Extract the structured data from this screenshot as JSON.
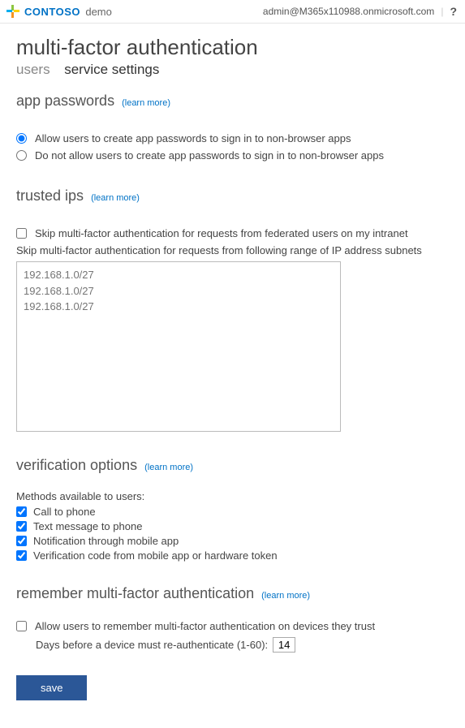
{
  "header": {
    "brand_name": "CONTOSO",
    "brand_suffix": "demo",
    "user_email": "admin@M365x110988.onmicrosoft.com",
    "help": "?"
  },
  "page": {
    "title": "multi-factor authentication"
  },
  "tabs": {
    "users": "users",
    "service_settings": "service settings"
  },
  "learn_more": "(learn more)",
  "app_passwords": {
    "heading": "app passwords",
    "allow": "Allow users to create app passwords to sign in to non-browser apps",
    "disallow": "Do not allow users to create app passwords to sign in to non-browser apps",
    "selected": "allow"
  },
  "trusted_ips": {
    "heading": "trusted ips",
    "skip_federated": "Skip multi-factor authentication for requests from federated users on my intranet",
    "skip_federated_checked": false,
    "range_label": "Skip multi-factor authentication for requests from following range of IP address subnets",
    "placeholder": "192.168.1.0/27\n192.168.1.0/27\n192.168.1.0/27"
  },
  "verification": {
    "heading": "verification options",
    "methods_label": "Methods available to users:",
    "methods": [
      {
        "label": "Call to phone",
        "checked": true
      },
      {
        "label": "Text message to phone",
        "checked": true
      },
      {
        "label": "Notification through mobile app",
        "checked": true
      },
      {
        "label": "Verification code from mobile app or hardware token",
        "checked": true
      }
    ]
  },
  "remember": {
    "heading": "remember multi-factor authentication",
    "allow_label": "Allow users to remember multi-factor authentication on devices they trust",
    "allow_checked": false,
    "days_label": "Days before a device must re-authenticate (1-60):",
    "days_value": "14"
  },
  "save": "save"
}
